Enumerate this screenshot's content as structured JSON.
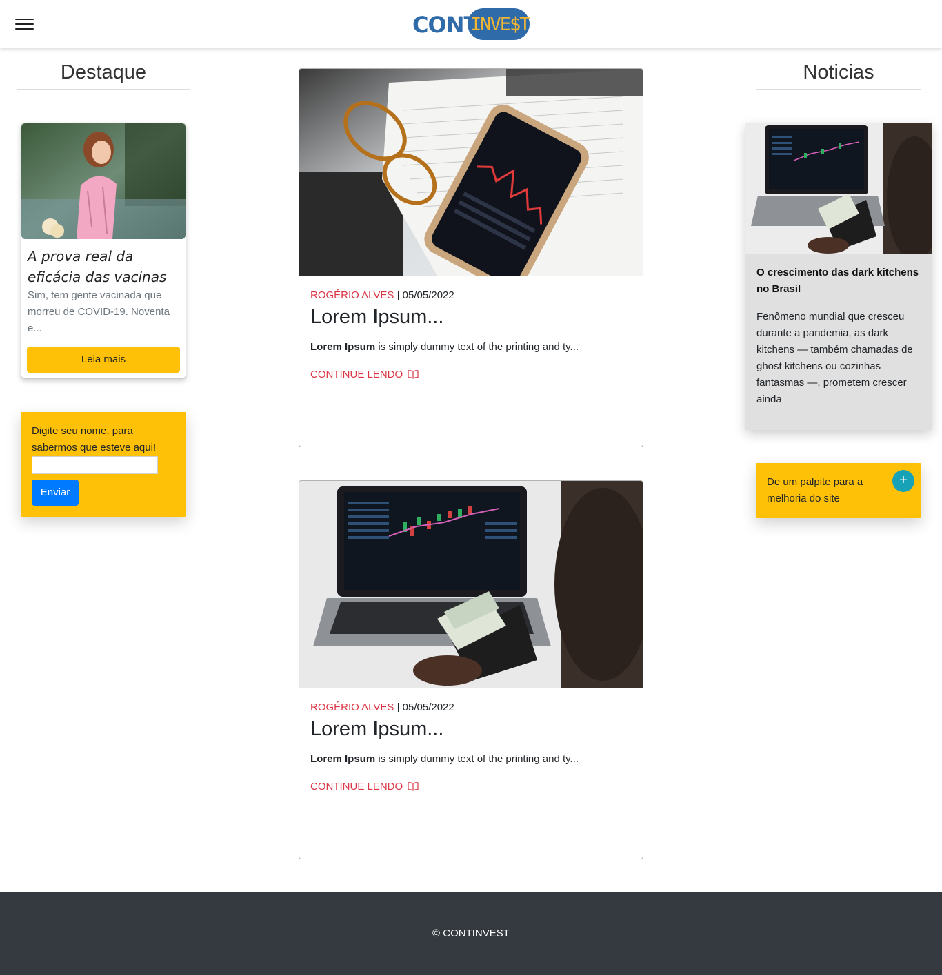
{
  "brand": {
    "prefix": "CONT",
    "suffix": "INVE$T"
  },
  "sidebar_left": {
    "title": "Destaque",
    "featured": {
      "title": "A prova real da eficácia das vacinas",
      "text": "Sim, tem gente vacinada que morreu de COVID-19. Noventa e...",
      "button": "Leia mais"
    },
    "name_form": {
      "label": "Digite seu nome, para sabermos que esteve aqui!",
      "input_value": "",
      "button": "Enviar"
    }
  },
  "posts": [
    {
      "author": "ROGÉRIO ALVES",
      "separator": " | ",
      "date": "05/05/2022",
      "title": "Lorem Ipsum...",
      "excerpt_bold": "Lorem Ipsum",
      "excerpt_rest": " is simply dummy text of the printing and ty...",
      "link": "CONTINUE LENDO"
    },
    {
      "author": "ROGÉRIO ALVES",
      "separator": " | ",
      "date": "05/05/2022",
      "title": "Lorem Ipsum...",
      "excerpt_bold": "Lorem Ipsum",
      "excerpt_rest": " is simply dummy text of the printing and ty...",
      "link": "CONTINUE LENDO"
    }
  ],
  "sidebar_right": {
    "title": "Noticias",
    "news": {
      "title": "O crescimento das dark kitchens no Brasil",
      "text": "Fenômeno mundial que cresceu durante a pandemia, as dark kitchens — também chamadas de ghost kitchens ou cozinhas fantasmas —, prometem crescer ainda"
    },
    "suggest": {
      "text": "De um palpite para a melhoria do site",
      "button": "+"
    }
  },
  "footer": {
    "text": "© CONTINVEST"
  },
  "colors": {
    "accent_yellow": "#ffc107",
    "brand_blue": "#2f6aa9",
    "link_red": "#dc3545",
    "button_blue": "#007bff",
    "teal": "#17a2b8",
    "footer_bg": "#343a40"
  },
  "icons": [
    "hamburger-menu-icon",
    "book-open-icon",
    "plus-icon"
  ]
}
